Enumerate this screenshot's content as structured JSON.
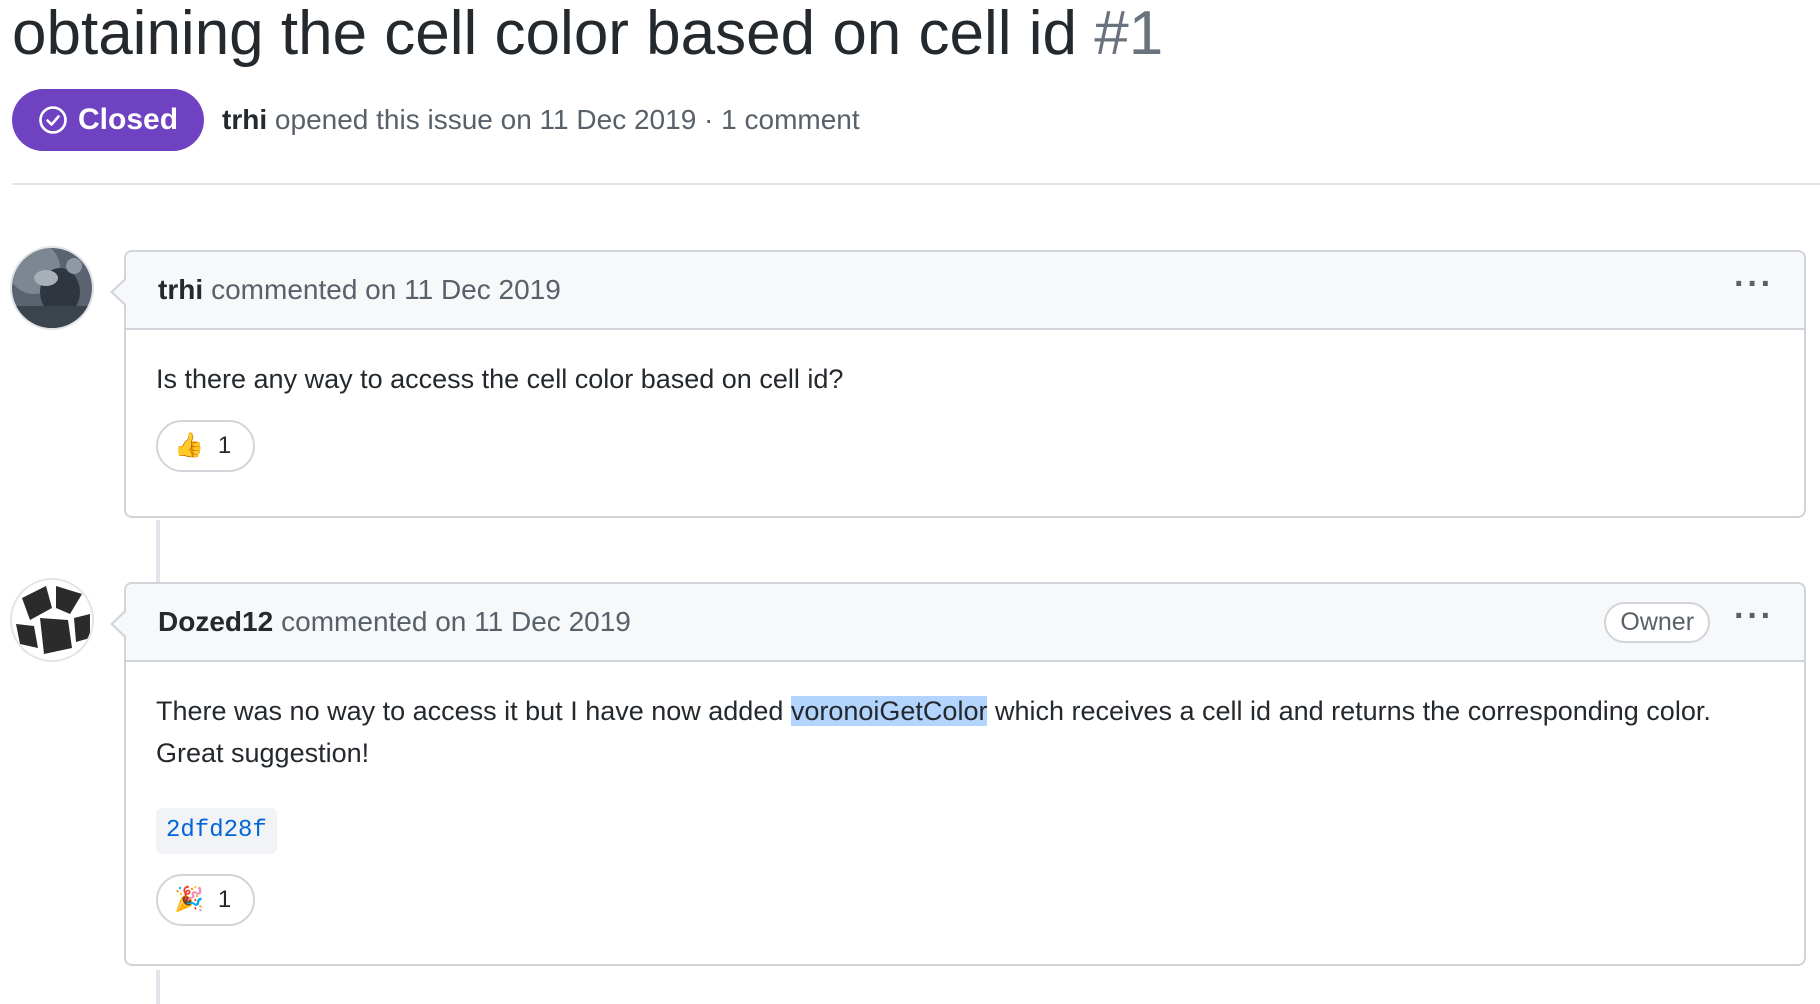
{
  "issue": {
    "title": "obtaining the cell color based on cell id",
    "number": "#1",
    "state": "Closed",
    "author": "trhi",
    "meta": "opened this issue on 11 Dec 2019 · 1 comment"
  },
  "comments": [
    {
      "author": "trhi",
      "action": "commented on 11 Dec 2019",
      "body": "Is there any way to access the cell color based on cell id?",
      "reaction": {
        "emoji": "👍",
        "count": "1"
      }
    },
    {
      "author": "Dozed12",
      "action": "commented on 11 Dec 2019",
      "role": "Owner",
      "body_before": "There was no way to access it but I have now added ",
      "body_highlight": "voronoiGetColor",
      "body_after": " which receives a cell id and returns the corresponding color. Great suggestion!",
      "commit": "2dfd28f",
      "reaction": {
        "emoji": "🎉",
        "count": "1"
      }
    }
  ],
  "colors": {
    "closed_badge": "#6f42c1",
    "link": "#0366d6",
    "selection": "#b3d4fc",
    "header_bg": "#f6f8fa",
    "border": "#d1d5da"
  },
  "icons": [
    "check-circle-icon",
    "kebab-menu-icon",
    "thumbs-up-icon",
    "tada-icon"
  ]
}
